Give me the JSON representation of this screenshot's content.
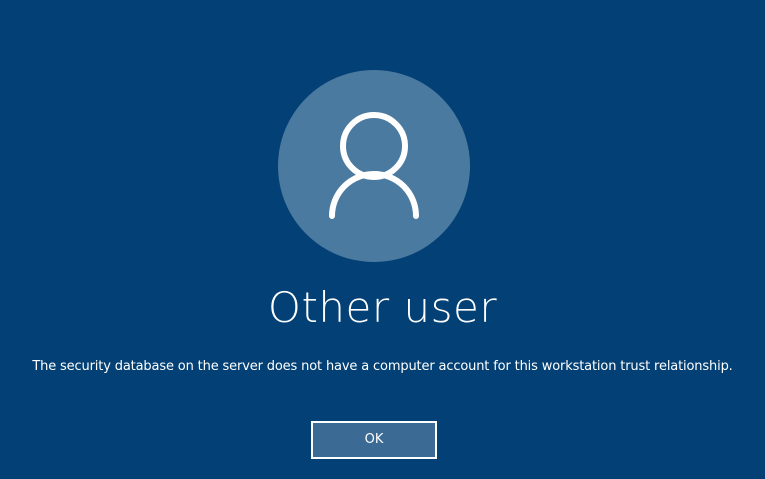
{
  "user": {
    "name": "Other user",
    "avatar_icon": "user-silhouette-icon"
  },
  "message": "The security database on the server does not have a computer account for this workstation trust relationship.",
  "actions": {
    "ok_label": "OK"
  },
  "colors": {
    "background": "#034075",
    "avatar_circle": "#4b7aa0",
    "button_fill": "#3b6b95",
    "text": "#ffffff"
  }
}
